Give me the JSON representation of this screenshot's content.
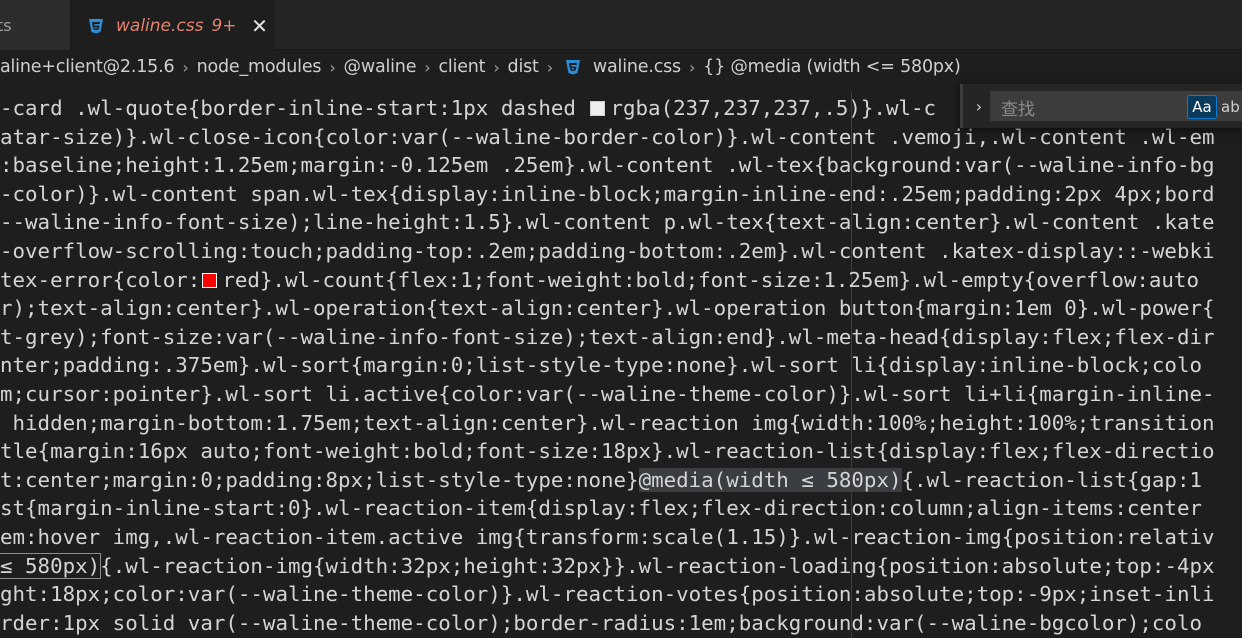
{
  "tabs": {
    "previous_label": "ts",
    "active": {
      "title": "waline.css",
      "badge": "9+",
      "close_glyph": "✕"
    }
  },
  "breadcrumb": {
    "items": [
      "aline+client@2.15.6",
      "node_modules",
      "@waline",
      "client",
      "dist",
      "waline.css",
      "{} @media (width <= 580px)"
    ],
    "separator": "›"
  },
  "find_widget": {
    "toggle_glyph": "›",
    "placeholder": "查找",
    "match_case_label": "Aa",
    "whole_word_label": "ab"
  },
  "code_lines": [
    {
      "segments": [
        {
          "t": "-card .wl-quote{border-inline-start:1px dashed "
        },
        {
          "swatch": "grey"
        },
        {
          "t": "rgba(237,237,237,.5)}.wl-c"
        }
      ]
    },
    {
      "segments": [
        {
          "t": "atar-size)}.wl-close-icon{color:var(--waline-border-color)}.wl-content .vemoji,.wl-content .wl-em"
        }
      ]
    },
    {
      "segments": [
        {
          "t": ":baseline;height:1.25em;margin:-0.125em .25em}.wl-content .wl-tex{background:var(--waline-info-bg"
        }
      ]
    },
    {
      "segments": [
        {
          "t": "-color)}.wl-content span.wl-tex{display:inline-block;margin-inline-end:.25em;padding:2px 4px;bord"
        }
      ]
    },
    {
      "segments": [
        {
          "t": "--waline-info-font-size);line-height:1.5}.wl-content p.wl-tex{text-align:center}.wl-content .kate"
        }
      ]
    },
    {
      "segments": [
        {
          "t": "-overflow-scrolling:touch;padding-top:.2em;padding-bottom:.2em}.wl-content .katex-display::-webki"
        }
      ]
    },
    {
      "segments": [
        {
          "t": "tex-error{color:"
        },
        {
          "swatch": "red"
        },
        {
          "t": "red}.wl-count{flex:1;font-weight:bold;font-size:1.25em}.wl-empty{overflow:auto"
        }
      ]
    },
    {
      "segments": [
        {
          "t": "r);text-align:center}.wl-operation{text-align:center}.wl-operation button{margin:1em 0}.wl-power{"
        }
      ]
    },
    {
      "segments": [
        {
          "t": "t-grey);font-size:var(--waline-info-font-size);text-align:end}.wl-meta-head{display:flex;flex-dir"
        }
      ]
    },
    {
      "segments": [
        {
          "t": "nter;padding:.375em}.wl-sort{margin:0;list-style-type:none}.wl-sort li{display:inline-block;colo"
        }
      ]
    },
    {
      "segments": [
        {
          "t": "m;cursor:pointer}.wl-sort li.active{color:var(--waline-theme-color)}.wl-sort li+li{margin-inline-"
        }
      ]
    },
    {
      "segments": [
        {
          "t": " hidden;margin-bottom:1.75em;text-align:center}.wl-reaction img{width:100%;height:100%;transition"
        }
      ]
    },
    {
      "segments": [
        {
          "t": "tle{margin:16px auto;font-weight:bold;font-size:18px}.wl-reaction-list{display:flex;flex-directio"
        }
      ]
    },
    {
      "segments": [
        {
          "t": "t:center;margin:0;padding:8px;list-style-type:none}"
        },
        {
          "t": "@media(width ≤ 580px)",
          "cls": "hl"
        },
        {
          "t": "{.wl-reaction-list{gap:1"
        }
      ]
    },
    {
      "segments": [
        {
          "t": "st{margin-inline-start:0}.wl-reaction-item{display:flex;flex-direction:column;align-items:center"
        }
      ]
    },
    {
      "segments": [
        {
          "t": "em:hover img,.wl-reaction-item.active img{transform:scale(1.15)}.wl-reaction-img{position:relativ"
        }
      ]
    },
    {
      "segments": [
        {
          "t": "≤ 580px)",
          "cls": "box"
        },
        {
          "t": "{.wl-reaction-img{width:32px;height:32px}}.wl-reaction-loading{position:absolute;top:-4px"
        }
      ]
    },
    {
      "segments": [
        {
          "t": "ght:18px;color:var(--waline-theme-color)}.wl-reaction-votes{position:absolute;top:-9px;inset-inli"
        }
      ]
    },
    {
      "segments": [
        {
          "t": "rder:1px solid var(--waline-theme-color);border-radius:1em;background:var(--waline-bgcolor);colo"
        }
      ]
    }
  ],
  "colors": {
    "editor_bg": "#1e1e1e",
    "tab_bar_bg": "#252526",
    "tab_title": "#e2826f",
    "css_icon": "#2d8ed8",
    "code_text": "#d4d4d4",
    "active_toggle_border": "#0e7ad3"
  },
  "icons": {
    "tab_file_icon": "css3-icon",
    "breadcrumb_file_icon": "css3-icon",
    "tab_close_icon": "close-icon",
    "find_toggle_icon": "chevron-right-icon"
  }
}
